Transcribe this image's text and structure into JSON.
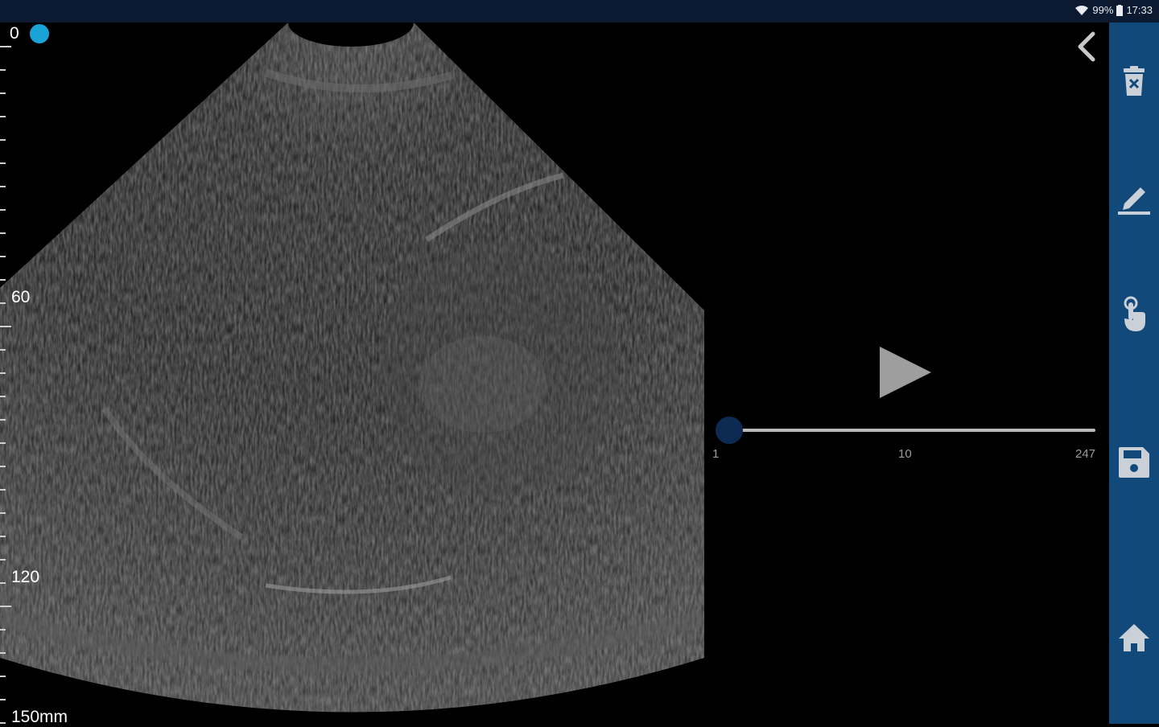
{
  "status_bar": {
    "wifi_icon": "wifi-icon",
    "battery_text": "99%",
    "battery_icon": "battery-icon",
    "time": "17:33"
  },
  "scale": {
    "labels": [
      "0",
      "60",
      "120",
      "150mm"
    ],
    "indicator_color": "#1aa3d6"
  },
  "cine": {
    "play_icon": "play-icon",
    "slider": {
      "min_label": "1",
      "mid_label": "10",
      "max_label": "247",
      "current_frame_value": 1
    }
  },
  "toolbar": {
    "back_icon": "chevron-left-icon",
    "items": [
      {
        "icon": "delete-icon"
      },
      {
        "icon": "annotate-pen-icon"
      },
      {
        "icon": "touch-hand-icon"
      },
      {
        "icon": "save-floppy-icon"
      },
      {
        "icon": "home-icon"
      }
    ]
  },
  "colors": {
    "sidebar": "#11497a",
    "status_bar": "#0b1a30",
    "slider_knob": "#0d2a52"
  }
}
